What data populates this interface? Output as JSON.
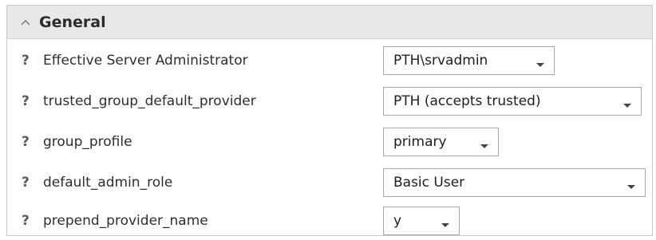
{
  "section": {
    "title": "General"
  },
  "icons": {
    "collapse": "chevron-up-icon",
    "help": "question-mark-icon",
    "dropdown": "chevron-down-icon"
  },
  "help_glyph": "?",
  "rows": [
    {
      "label": "Effective Server Administrator",
      "value": "PTH\\srvadmin"
    },
    {
      "label": "trusted_group_default_provider",
      "value": "PTH (accepts trusted)"
    },
    {
      "label": "group_profile",
      "value": "primary"
    },
    {
      "label": "default_admin_role",
      "value": "Basic User"
    },
    {
      "label": "prepend_provider_name",
      "value": "y"
    }
  ],
  "colors": {
    "header_bg": "#e8e8e8",
    "border": "#c9c9c9"
  }
}
